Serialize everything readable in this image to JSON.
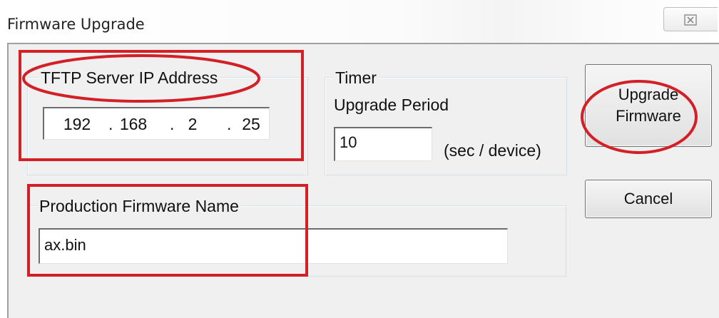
{
  "window": {
    "title": "Firmware Upgrade",
    "close_glyph": "☒"
  },
  "tftp": {
    "group_label": "TFTP Server IP Address",
    "octets": [
      "192",
      "168",
      "2",
      "25"
    ]
  },
  "timer": {
    "group_label": "Timer",
    "period_label": "Upgrade Period",
    "value": "10",
    "unit": "(sec / device)"
  },
  "firmware": {
    "group_label": "Production Firmware Name",
    "value": "ax.bin"
  },
  "buttons": {
    "upgrade_line1": "Upgrade",
    "upgrade_line2": "Firmware",
    "cancel": "Cancel"
  },
  "annotation_color": "#d32027"
}
